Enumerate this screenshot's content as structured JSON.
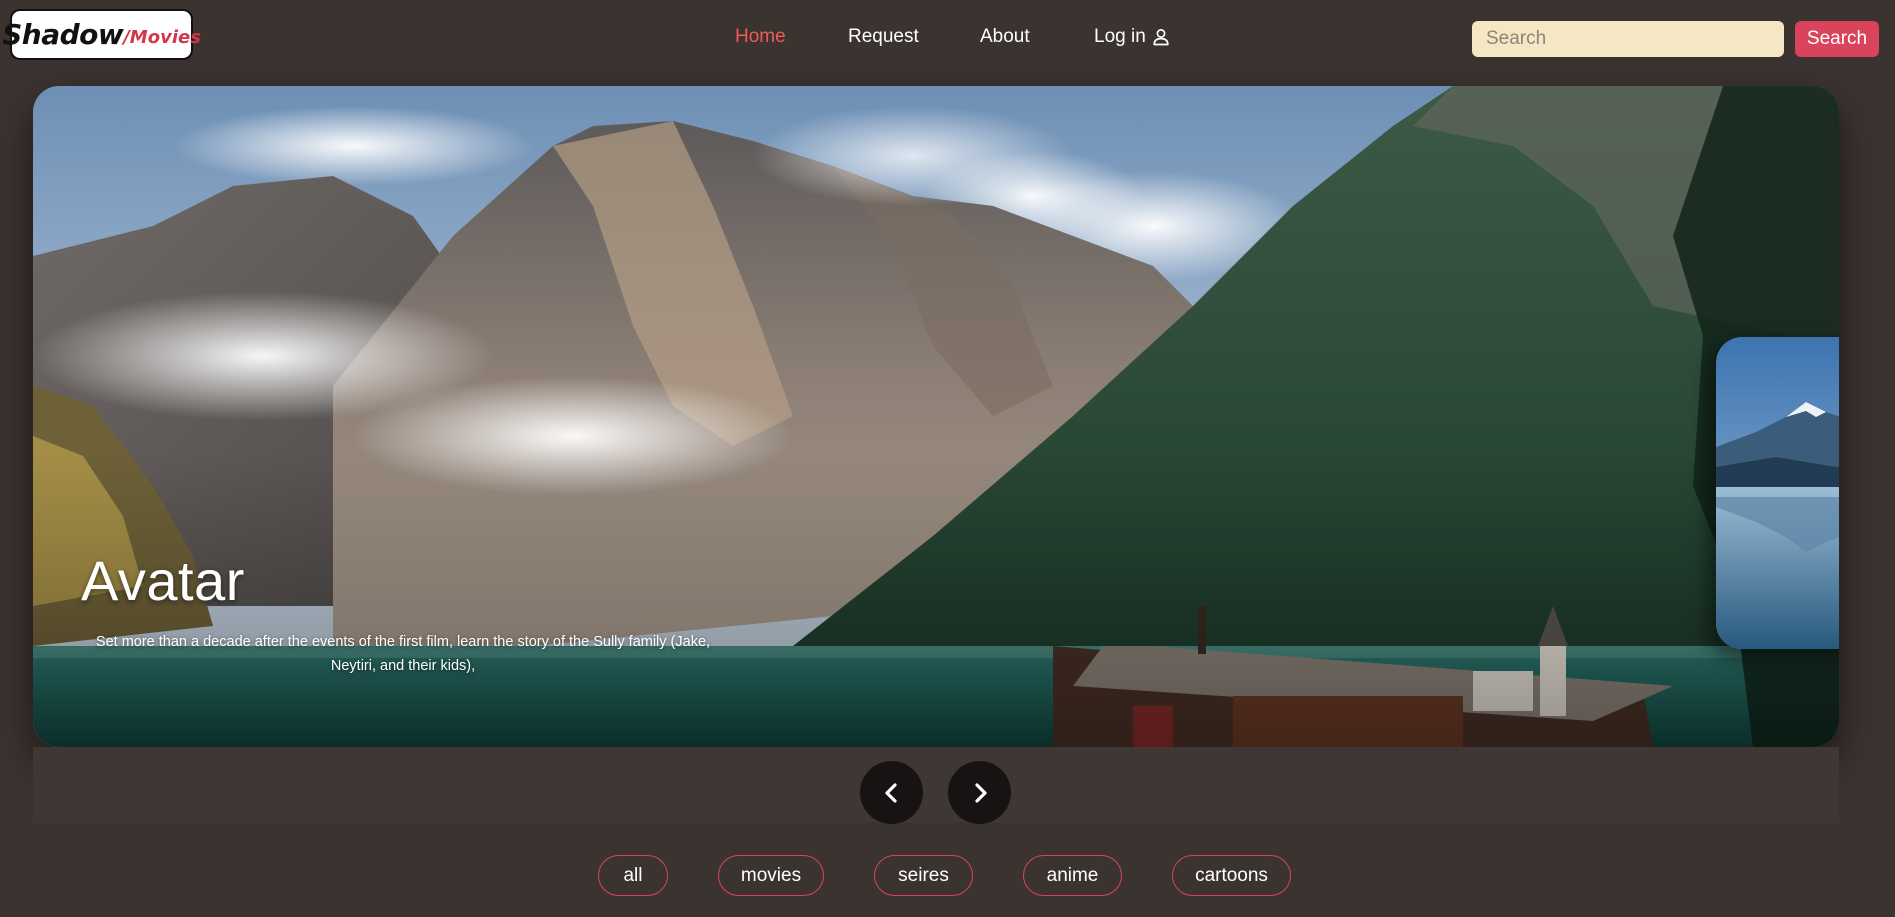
{
  "logo": {
    "primary": "Shadow",
    "secondary": "/Movies"
  },
  "nav": {
    "home": "Home",
    "request": "Request",
    "about": "About",
    "login": "Log in"
  },
  "search": {
    "placeholder": "Search",
    "button_label": "Search"
  },
  "hero": {
    "title": "Avatar",
    "description": "Set more than a decade after the events of the first film, learn the story of the Sully family (Jake, Neytiri, and their kids),"
  },
  "categories": [
    "all",
    "movies",
    "seires",
    "anime",
    "cartoons"
  ],
  "colors": {
    "background": "#3b3330",
    "accent": "#d9435c",
    "active_nav": "#ef5b5b",
    "search_bg": "#f5e6c4"
  },
  "icons": {
    "login": "user-icon",
    "prev": "chevron-left-icon",
    "next": "chevron-right-icon"
  }
}
